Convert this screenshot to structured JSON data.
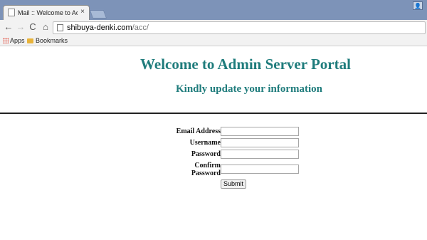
{
  "browser": {
    "tab": {
      "title": "Mail :: Welcome to Admin",
      "close": "×"
    },
    "nav": {
      "back": "←",
      "forward": "→",
      "reload": "C",
      "home": "⌂"
    },
    "address": {
      "host": "shibuya-denki.com",
      "path": "/acc/"
    },
    "bookmarks": [
      {
        "label": "Apps"
      },
      {
        "label": "Bookmarks"
      }
    ]
  },
  "page": {
    "title": "Welcome to Admin Server Portal",
    "subtitle": "Kindly update your information"
  },
  "form": {
    "email_label": "Email Address",
    "username_label": "Username",
    "password_label": "Password",
    "confirm_label_line1": "Confirm",
    "confirm_label_line2": "Password",
    "email_value": "",
    "username_value": "",
    "password_value": "",
    "confirm_value": "",
    "submit_label": "Submit"
  },
  "icons": [
    "page-icon",
    "close-icon",
    "back-arrow-icon",
    "forward-arrow-icon",
    "reload-icon",
    "home-icon",
    "apps-grid-icon",
    "folder-icon",
    "profile-icon"
  ]
}
